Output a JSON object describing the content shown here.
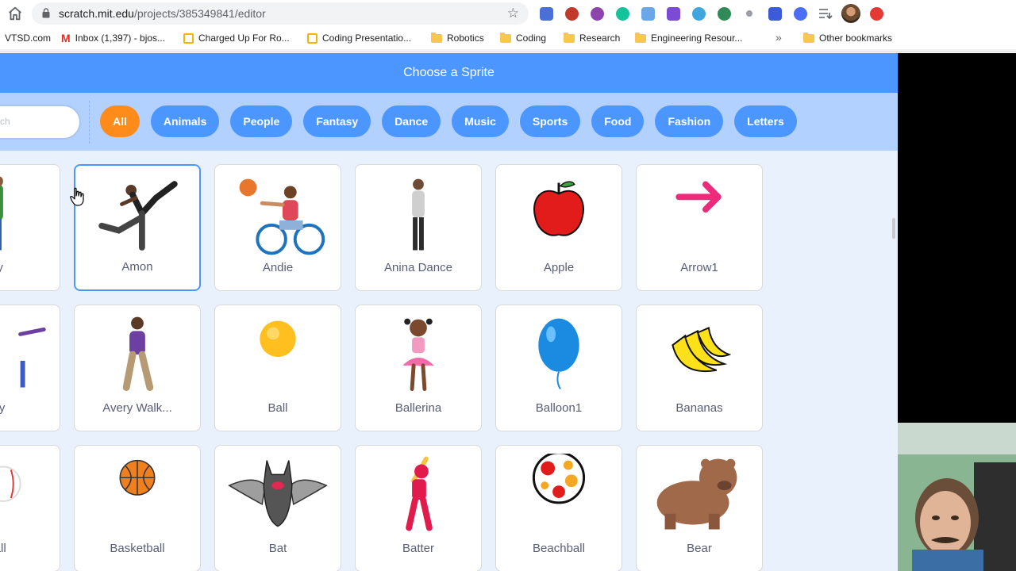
{
  "browser": {
    "url_host": "scratch.mit.edu",
    "url_path": "/projects/385349841/editor",
    "bookmarks": [
      {
        "label": "VTSD.com",
        "icon": "web-icon"
      },
      {
        "label": "Inbox (1,397) - bjos...",
        "icon": "gmail-icon"
      },
      {
        "label": "Charged Up For Ro...",
        "icon": "slides-icon"
      },
      {
        "label": "Coding Presentatio...",
        "icon": "slides-icon"
      },
      {
        "label": "Robotics",
        "icon": "folder-icon"
      },
      {
        "label": "Coding",
        "icon": "folder-icon"
      },
      {
        "label": "Research",
        "icon": "folder-icon"
      },
      {
        "label": "Engineering Resour...",
        "icon": "folder-icon"
      }
    ],
    "more_bookmarks": "»",
    "other_bookmarks": "Other bookmarks",
    "extensions": [
      {
        "icon": "calendar-icon",
        "color": "#4a6fd6"
      },
      {
        "icon": "abc-icon",
        "color": "#c0392b"
      },
      {
        "icon": "coupon-icon",
        "color": "#8e44ad"
      },
      {
        "icon": "grammarly-icon",
        "color": "#15c39a"
      },
      {
        "icon": "share-icon",
        "color": "#6aa7e8"
      },
      {
        "icon": "puzzle-icon",
        "color": "#7b4bd6"
      },
      {
        "icon": "screencastify-icon",
        "color": "#3fa6e0"
      },
      {
        "icon": "clock-icon",
        "color": "#2e8b57"
      },
      {
        "icon": "pin-icon",
        "color": "#9aa0a6"
      },
      {
        "icon": "c-icon",
        "color": "#3b5bdb"
      },
      {
        "icon": "k-icon",
        "color": "#4c6ef5"
      },
      {
        "icon": "reading-list-icon",
        "color": "#5f6368"
      }
    ]
  },
  "library": {
    "title": "Choose a Sprite",
    "search_placeholder": "ch",
    "tags": [
      "All",
      "Animals",
      "People",
      "Fantasy",
      "Dance",
      "Music",
      "Sports",
      "Food",
      "Fashion",
      "Letters"
    ],
    "active_tag": "All",
    "sprites": [
      {
        "name": "oy",
        "art": "person-icon"
      },
      {
        "name": "Amon",
        "art": "dancer-icon",
        "selected": true
      },
      {
        "name": "Andie",
        "art": "wheelchair-basketball-icon"
      },
      {
        "name": "Anina Dance",
        "art": "dancer-icon"
      },
      {
        "name": "Apple",
        "art": "apple-icon"
      },
      {
        "name": "Arrow1",
        "art": "arrow-icon"
      },
      {
        "name": "ery",
        "art": "person-icon"
      },
      {
        "name": "Avery Walk...",
        "art": "walking-person-icon"
      },
      {
        "name": "Ball",
        "art": "ball-icon"
      },
      {
        "name": "Ballerina",
        "art": "ballerina-icon"
      },
      {
        "name": "Balloon1",
        "art": "balloon-icon"
      },
      {
        "name": "Bananas",
        "art": "bananas-icon"
      },
      {
        "name": "ball",
        "art": "baseball-icon"
      },
      {
        "name": "Basketball",
        "art": "basketball-icon"
      },
      {
        "name": "Bat",
        "art": "bat-icon"
      },
      {
        "name": "Batter",
        "art": "batter-icon"
      },
      {
        "name": "Beachball",
        "art": "beachball-icon"
      },
      {
        "name": "Bear",
        "art": "bear-icon"
      }
    ]
  },
  "colors": {
    "header": "#4c97ff",
    "filter_bar": "#b3d1ff",
    "active_tag": "#ff8c1a",
    "tag": "#4c97ff",
    "library_bg": "#e9f1fc"
  }
}
